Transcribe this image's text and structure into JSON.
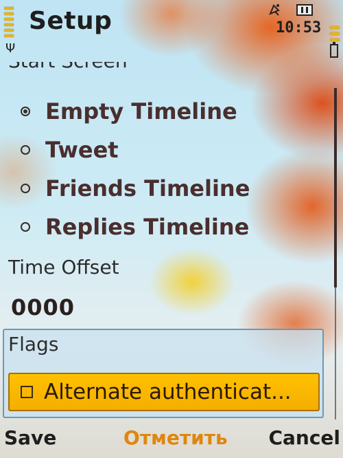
{
  "header": {
    "title": "Setup",
    "time": "10:53"
  },
  "icons": {
    "signal": "signal-strength-icon",
    "antenna": "antenna-icon",
    "alarm": "alarm-icon",
    "message": "message-icon",
    "battery": "battery-icon"
  },
  "start_screen": {
    "label": "Start Screen",
    "options": [
      {
        "label": "Empty Timeline",
        "selected": true
      },
      {
        "label": "Tweet",
        "selected": false
      },
      {
        "label": "Friends Timeline",
        "selected": false
      },
      {
        "label": "Replies Timeline",
        "selected": false
      }
    ]
  },
  "time_offset": {
    "label": "Time Offset",
    "value": "0000"
  },
  "flags": {
    "label": "Flags",
    "items": [
      {
        "label": "Alternate authenticat...",
        "checked": false
      }
    ]
  },
  "softkeys": {
    "left": "Save",
    "middle": "Отметить",
    "right": "Cancel"
  },
  "colors": {
    "highlight": "#ffc100",
    "middle_softkey": "#e0860f",
    "option_text": "#4a2e2e"
  }
}
